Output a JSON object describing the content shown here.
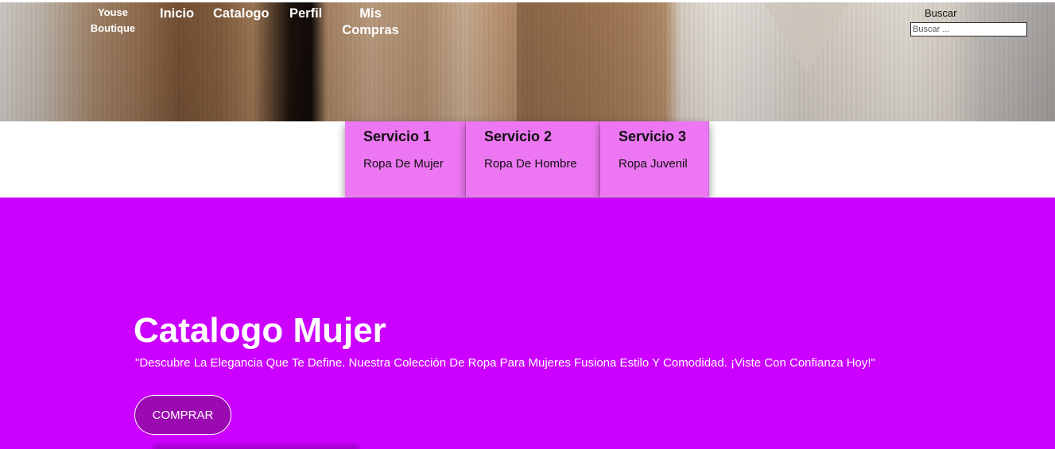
{
  "header": {
    "brand": "Youse Boutique",
    "nav": {
      "inicio": "Inicio",
      "catalogo": "Catalogo",
      "perfil": "Perfil",
      "mis_compras": "Mis Compras"
    },
    "search": {
      "label": "Buscar",
      "placeholder": "Buscar ..."
    }
  },
  "services": [
    {
      "title": "Servicio 1",
      "desc": "Ropa De Mujer"
    },
    {
      "title": "Servicio 2",
      "desc": "Ropa De Hombre"
    },
    {
      "title": "Servicio 3",
      "desc": "Ropa Juvenil"
    }
  ],
  "catalog": {
    "title": "Catalogo Mujer",
    "description": "\"Descubre La Elegancia Que Te Define. Nuestra Colección De Ropa Para Mujeres Fusiona Estilo Y Comodidad. ¡Viste Con Confianza Hoy!\"",
    "button": "COMPRAR"
  },
  "colors": {
    "accent": "#cc00ff",
    "service_card": "#ed77f2",
    "button": "#9a0ab0"
  }
}
